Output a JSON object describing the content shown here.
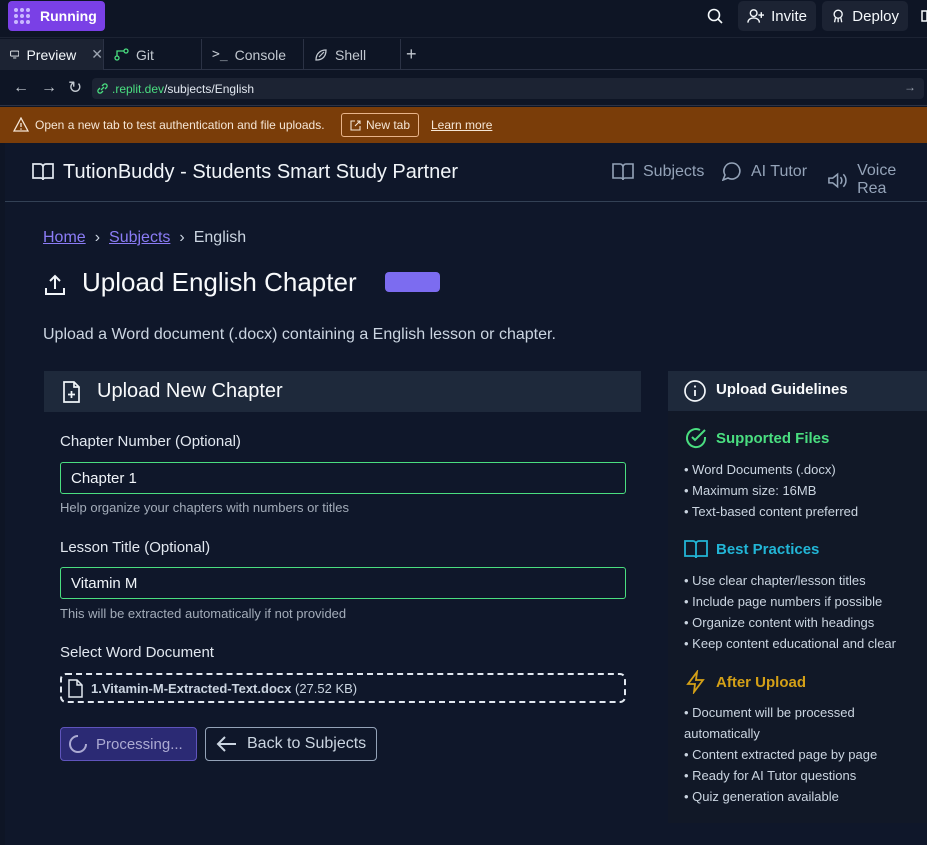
{
  "topbar": {
    "status": "Running",
    "invite": "Invite",
    "deploy": "Deploy"
  },
  "tabs": [
    {
      "label": "Preview"
    },
    {
      "label": "Git"
    },
    {
      "label": "Console"
    },
    {
      "label": "Shell"
    }
  ],
  "urlbar": {
    "domain": ".replit.dev",
    "path": "/subjects/English"
  },
  "warning": {
    "text": "Open a new tab to test authentication and file uploads.",
    "new_tab": "New tab",
    "learn_more": "Learn more"
  },
  "header": {
    "title": "TutionBuddy - Students Smart Study Partner",
    "nav": [
      "Subjects",
      "AI Tutor",
      "Voice Rea"
    ]
  },
  "breadcrumb": {
    "home": "Home",
    "sep": "›",
    "subjects": "Subjects",
    "current": "English"
  },
  "page": {
    "title": "Upload English Chapter",
    "description": "Upload a Word document (.docx) containing a English lesson or chapter."
  },
  "form": {
    "card_title": "Upload New Chapter",
    "chapter_label": "Chapter Number (Optional)",
    "chapter_value": "Chapter 1",
    "chapter_help": "Help organize your chapters with numbers or titles",
    "lesson_label": "Lesson Title (Optional)",
    "lesson_value": "Vitamin M",
    "lesson_help": "This will be extracted automatically if not provided",
    "doc_label": "Select Word Document",
    "file_name": "1.Vitamin-M-Extracted-Text.docx",
    "file_size": "(27.52 KB)",
    "processing": "Processing...",
    "back": "Back to Subjects"
  },
  "guidelines": {
    "title": "Upload Guidelines",
    "supported_title": "Supported Files",
    "supported": [
      "• Word Documents (.docx)",
      "• Maximum size: 16MB",
      "• Text-based content preferred"
    ],
    "practices_title": "Best Practices",
    "practices": [
      "• Use clear chapter/lesson titles",
      "• Include page numbers if possible",
      "• Organize content with headings",
      "• Keep content educational and clear"
    ],
    "after_title": "After Upload",
    "after": [
      "• Document will be processed",
      "automatically",
      "• Content extracted page by page",
      "• Ready for AI Tutor questions",
      "• Quiz generation available"
    ]
  },
  "colors": {
    "accent": "#7c6cf0",
    "success": "#4ade80",
    "info": "#22b5d6",
    "warning": "#d4a017"
  }
}
